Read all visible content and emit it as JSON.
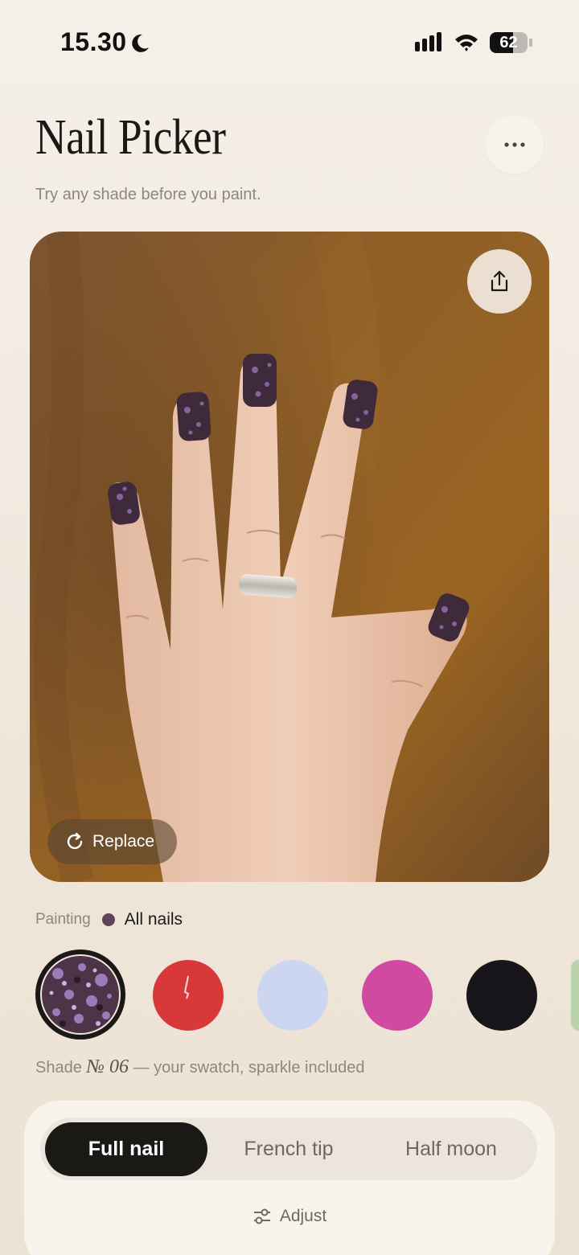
{
  "status_bar": {
    "time": "15.30",
    "battery": "62",
    "battery_level": 0.62
  },
  "header": {
    "title": "Nail Picker",
    "subtitle": "Try any shade before you paint."
  },
  "photo": {
    "replace_label": "Replace"
  },
  "painting": {
    "label": "Painting",
    "target": "All nails",
    "dot_color": "#5e4656"
  },
  "swatches": [
    {
      "name": "glitter-plum",
      "color": "#5b4258",
      "selected": true
    },
    {
      "name": "red",
      "color": "#d8383a",
      "selected": false
    },
    {
      "name": "periwinkle",
      "color": "#cdd6f0",
      "selected": false
    },
    {
      "name": "magenta",
      "color": "#cf4aa0",
      "selected": false
    },
    {
      "name": "black",
      "color": "#17151a",
      "selected": false
    },
    {
      "name": "sage",
      "color": "#b9d3ab",
      "selected": false
    }
  ],
  "shade": {
    "prefix": "Shade",
    "number": "№ 06",
    "suffix": "— your swatch, sparkle included"
  },
  "modes": {
    "full_nail": "Full nail",
    "french_tip": "French tip",
    "half_moon": "Half moon",
    "active": "Full nail"
  },
  "adjust": {
    "label": "Adjust"
  },
  "icons": [
    "moon-icon",
    "signal-icon",
    "wifi-icon",
    "battery-icon",
    "more-icon",
    "share-icon",
    "refresh-icon",
    "sliders-icon"
  ]
}
